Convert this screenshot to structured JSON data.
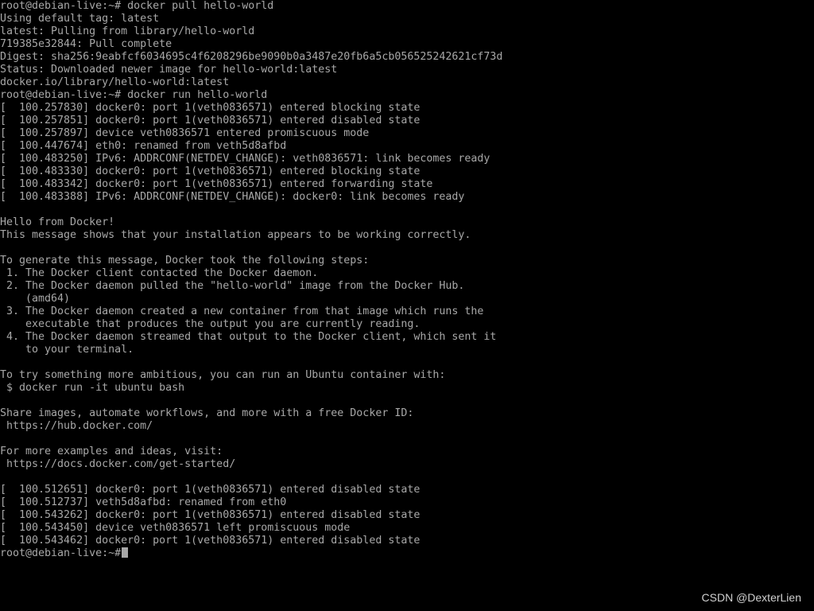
{
  "terminal": {
    "lines": [
      "root@debian-live:~# docker pull hello-world",
      "Using default tag: latest",
      "latest: Pulling from library/hello-world",
      "719385e32844: Pull complete",
      "Digest: sha256:9eabfcf6034695c4f6208296be9090b0a3487e20fb6a5cb056525242621cf73d",
      "Status: Downloaded newer image for hello-world:latest",
      "docker.io/library/hello-world:latest",
      "root@debian-live:~# docker run hello-world",
      "[  100.257830] docker0: port 1(veth0836571) entered blocking state",
      "[  100.257851] docker0: port 1(veth0836571) entered disabled state",
      "[  100.257897] device veth0836571 entered promiscuous mode",
      "[  100.447674] eth0: renamed from veth5d8afbd",
      "[  100.483250] IPv6: ADDRCONF(NETDEV_CHANGE): veth0836571: link becomes ready",
      "[  100.483330] docker0: port 1(veth0836571) entered blocking state",
      "[  100.483342] docker0: port 1(veth0836571) entered forwarding state",
      "[  100.483388] IPv6: ADDRCONF(NETDEV_CHANGE): docker0: link becomes ready",
      "",
      "Hello from Docker!",
      "This message shows that your installation appears to be working correctly.",
      "",
      "To generate this message, Docker took the following steps:",
      " 1. The Docker client contacted the Docker daemon.",
      " 2. The Docker daemon pulled the \"hello-world\" image from the Docker Hub.",
      "    (amd64)",
      " 3. The Docker daemon created a new container from that image which runs the",
      "    executable that produces the output you are currently reading.",
      " 4. The Docker daemon streamed that output to the Docker client, which sent it",
      "    to your terminal.",
      "",
      "To try something more ambitious, you can run an Ubuntu container with:",
      " $ docker run -it ubuntu bash",
      "",
      "Share images, automate workflows, and more with a free Docker ID:",
      " https://hub.docker.com/",
      "",
      "For more examples and ideas, visit:",
      " https://docs.docker.com/get-started/",
      "",
      "[  100.512651] docker0: port 1(veth0836571) entered disabled state",
      "[  100.512737] veth5d8afbd: renamed from eth0",
      "[  100.543262] docker0: port 1(veth0836571) entered disabled state",
      "[  100.543450] device veth0836571 left promiscuous mode",
      "[  100.543462] docker0: port 1(veth0836571) entered disabled state"
    ],
    "prompt": "root@debian-live:~#",
    "text_color": "#a8a8a8",
    "background_color": "#000000"
  },
  "watermark": {
    "text": "CSDN @DexterLien"
  }
}
